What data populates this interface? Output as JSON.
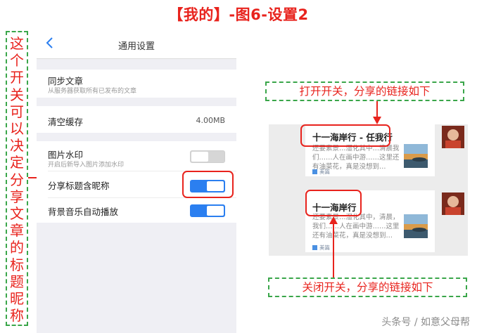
{
  "page_title": "【我的】-图6-设置2",
  "side_annotation": "这个开关可以决定分享文章的标题昵称",
  "settings": {
    "nav_title": "通用设置",
    "sync_title": "同步文章",
    "sync_sub": "从服务器获取所有已发布的文章",
    "cache_title": "清空缓存",
    "cache_value": "4.00MB",
    "watermark_title": "图片水印",
    "watermark_sub": "开启后新导入图片添加水印",
    "share_nickname_title": "分享标题含昵称",
    "bgmusic_title": "背景音乐自动播放"
  },
  "toggles": {
    "watermark": "off",
    "share_nickname": "on",
    "bgmusic": "on"
  },
  "caption_on": "打开开关，分享的链接如下",
  "caption_off": "关闭开关，分享的链接如下",
  "card_on": {
    "title": "十一海岸行 - 任我行",
    "body": "还要素景…湿化其中…清晨我们……人在画中游……这里还有油菜花，真是没想到…",
    "foot": "美篇"
  },
  "card_off": {
    "title": "十一海岸行",
    "body": "还要素景…湿化其中，清晨，我们……人在画中游……这里还有油菜花，真是没想到…",
    "foot": "美篇"
  },
  "watermark": "头条号 / 如意父母帮",
  "colors": {
    "accent_red": "#e8231d",
    "dash_green": "#3aa64a",
    "toggle_blue": "#2b7ff0"
  }
}
